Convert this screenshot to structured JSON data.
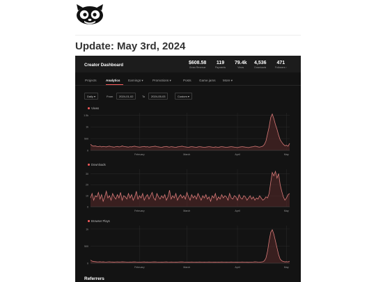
{
  "post": {
    "title": "Update: May 3rd, 2024"
  },
  "dashboard": {
    "title": "Creator Dashboard",
    "stats": [
      {
        "value": "$608.58",
        "label": "Gross Revenue"
      },
      {
        "value": "119",
        "label": "Payments"
      },
      {
        "value": "79.4k",
        "label": "Views"
      },
      {
        "value": "4,536",
        "label": "Downloads"
      },
      {
        "value": "471",
        "label": "Followers ›"
      }
    ],
    "tabs": [
      "Projects",
      "Analytics",
      "Earnings ▾",
      "Promotions ▾",
      "Posts",
      "Game jams",
      "More ▾"
    ],
    "active_tab": "Analytics",
    "controls": {
      "interval": "Daily ▾",
      "from_label": "From",
      "from_value": "2024-01-02",
      "to_label": "To",
      "to_value": "2024-05-03",
      "range": "Custom ▾"
    },
    "section_referrers": "Referrers"
  },
  "colors": {
    "accent": "#fa5c5c",
    "background": "#131313",
    "line": "#d87a78"
  },
  "chart_data": [
    {
      "type": "area",
      "title": "Views",
      "yticks": [
        "1.5k",
        "1k",
        "500",
        "0"
      ],
      "ytick_values": [
        1500,
        1000,
        500,
        0
      ],
      "ylim": [
        0,
        1600
      ],
      "xticks": [
        "February",
        "March",
        "April",
        "May"
      ],
      "x_start": "2024-01-02",
      "x_end": "2024-05-03",
      "values": [
        260,
        200,
        180,
        190,
        170,
        160,
        180,
        150,
        170,
        160,
        150,
        170,
        180,
        160,
        150,
        140,
        160,
        170,
        150,
        160,
        190,
        170,
        160,
        150,
        140,
        160,
        150,
        170,
        180,
        160,
        150,
        140,
        150,
        160,
        170,
        150,
        160,
        140,
        150,
        160,
        170,
        180,
        160,
        150,
        140,
        130,
        150,
        160,
        170,
        150,
        140,
        160,
        150,
        140,
        130,
        150,
        160,
        170,
        180,
        160,
        150,
        140,
        130,
        150,
        160,
        150,
        140,
        130,
        150,
        160,
        150,
        140,
        130,
        140,
        150,
        160,
        150,
        140,
        130,
        150,
        140,
        130,
        150,
        160,
        150,
        140,
        130,
        140,
        150,
        160,
        150,
        140,
        130,
        120,
        140,
        150,
        160,
        150,
        140,
        130,
        120,
        140,
        150,
        160,
        180,
        170,
        150,
        140,
        160,
        180,
        250,
        400,
        700,
        1000,
        1400,
        1550,
        1350,
        1100,
        900,
        650,
        450,
        350,
        260,
        200,
        220,
        180,
        300
      ]
    },
    {
      "type": "area",
      "title": "Downloads",
      "yticks": [
        "30",
        "20",
        "10",
        "0"
      ],
      "ytick_values": [
        30,
        20,
        10,
        0
      ],
      "ylim": [
        0,
        34
      ],
      "xticks": [
        "February",
        "March",
        "April",
        "May"
      ],
      "x_start": "2024-01-02",
      "x_end": "2024-05-03",
      "values": [
        8,
        12,
        6,
        10,
        9,
        13,
        7,
        11,
        5,
        9,
        14,
        8,
        10,
        6,
        12,
        9,
        7,
        11,
        8,
        13,
        6,
        10,
        9,
        7,
        12,
        8,
        11,
        6,
        9,
        14,
        7,
        10,
        8,
        12,
        6,
        9,
        11,
        7,
        10,
        13,
        8,
        6,
        12,
        9,
        7,
        10,
        8,
        11,
        6,
        9,
        15,
        7,
        10,
        8,
        12,
        6,
        9,
        11,
        8,
        10,
        7,
        13,
        9,
        6,
        11,
        8,
        10,
        7,
        12,
        9,
        6,
        10,
        8,
        11,
        7,
        9,
        5,
        10,
        8,
        12,
        6,
        9,
        7,
        11,
        8,
        10,
        9,
        6,
        12,
        8,
        7,
        10,
        9,
        6,
        11,
        8,
        7,
        10,
        9,
        6,
        8,
        10,
        7,
        9,
        6,
        8,
        7,
        10,
        8,
        6,
        7,
        9,
        8,
        12,
        22,
        31,
        28,
        32,
        26,
        30,
        20,
        14,
        9,
        6,
        8,
        11,
        12
      ]
    },
    {
      "type": "area",
      "title": "Browser Plays",
      "yticks": [
        "1k",
        "500",
        "0"
      ],
      "ytick_values": [
        1000,
        500,
        0
      ],
      "ylim": [
        0,
        1100
      ],
      "xticks": [
        "February",
        "March",
        "April",
        "May"
      ],
      "x_start": "2024-01-02",
      "x_end": "2024-05-03",
      "values": [
        90,
        60,
        50,
        45,
        40,
        38,
        42,
        36,
        40,
        35,
        33,
        38,
        40,
        36,
        34,
        32,
        35,
        38,
        34,
        36,
        40,
        37,
        35,
        33,
        31,
        35,
        33,
        37,
        39,
        35,
        33,
        31,
        33,
        35,
        37,
        33,
        35,
        31,
        33,
        35,
        37,
        39,
        35,
        33,
        31,
        29,
        33,
        35,
        37,
        33,
        31,
        35,
        33,
        31,
        29,
        33,
        35,
        37,
        39,
        35,
        33,
        31,
        29,
        33,
        35,
        33,
        31,
        29,
        33,
        35,
        33,
        31,
        29,
        31,
        33,
        35,
        33,
        31,
        29,
        33,
        31,
        29,
        33,
        35,
        33,
        31,
        29,
        31,
        33,
        35,
        33,
        31,
        29,
        27,
        31,
        33,
        35,
        33,
        31,
        29,
        27,
        31,
        33,
        35,
        40,
        38,
        33,
        31,
        35,
        40,
        70,
        150,
        350,
        650,
        900,
        980,
        850,
        650,
        450,
        250,
        120,
        70,
        50,
        40,
        45,
        38,
        60
      ]
    }
  ]
}
